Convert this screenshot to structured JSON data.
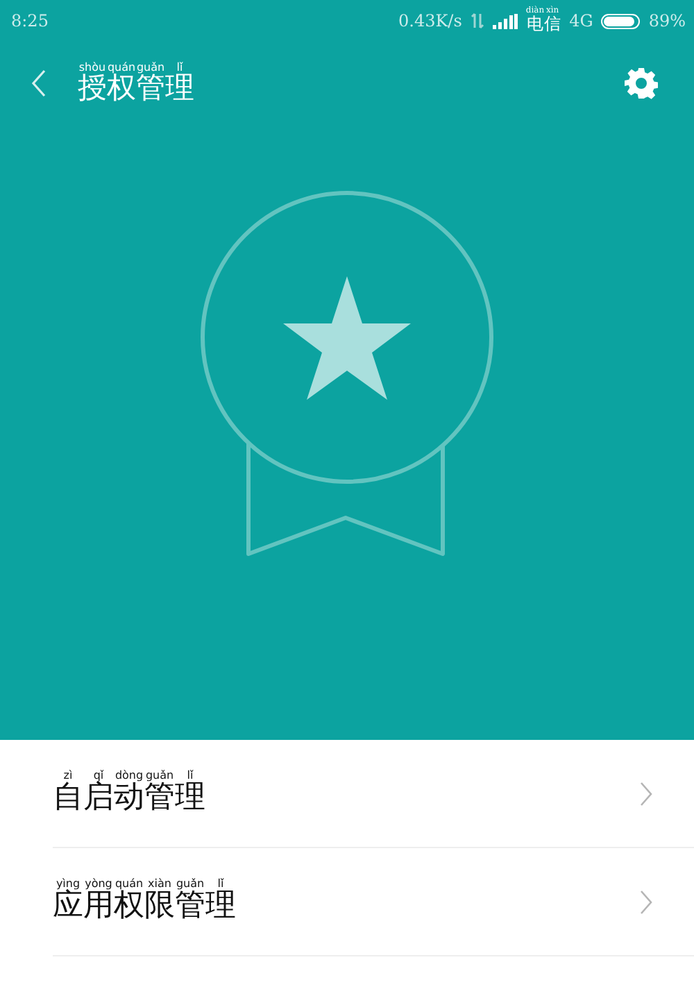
{
  "status_bar": {
    "time": "8:25",
    "speed": "0.43K/s",
    "carrier": [
      {
        "hanzi": "电",
        "pinyin": "diàn"
      },
      {
        "hanzi": "信",
        "pinyin": "xìn"
      }
    ],
    "network": "4G",
    "battery": {
      "level": 0.89
    },
    "battery_text": "89%"
  },
  "header": {
    "title": [
      {
        "hanzi": "授",
        "pinyin": "shòu"
      },
      {
        "hanzi": "权",
        "pinyin": "quán"
      },
      {
        "hanzi": "管",
        "pinyin": "guǎn"
      },
      {
        "hanzi": "理",
        "pinyin": "lǐ"
      }
    ]
  },
  "items": [
    {
      "label": [
        {
          "hanzi": "自",
          "pinyin": "zì"
        },
        {
          "hanzi": "启",
          "pinyin": "qǐ"
        },
        {
          "hanzi": "动",
          "pinyin": "dòng"
        },
        {
          "hanzi": "管",
          "pinyin": "guǎn"
        },
        {
          "hanzi": "理",
          "pinyin": "lǐ"
        }
      ]
    },
    {
      "label": [
        {
          "hanzi": "应",
          "pinyin": "yìng"
        },
        {
          "hanzi": "用",
          "pinyin": "yòng"
        },
        {
          "hanzi": "权",
          "pinyin": "quán"
        },
        {
          "hanzi": "限",
          "pinyin": "xiàn"
        },
        {
          "hanzi": "管",
          "pinyin": "guǎn"
        },
        {
          "hanzi": "理",
          "pinyin": "lǐ"
        }
      ]
    }
  ]
}
